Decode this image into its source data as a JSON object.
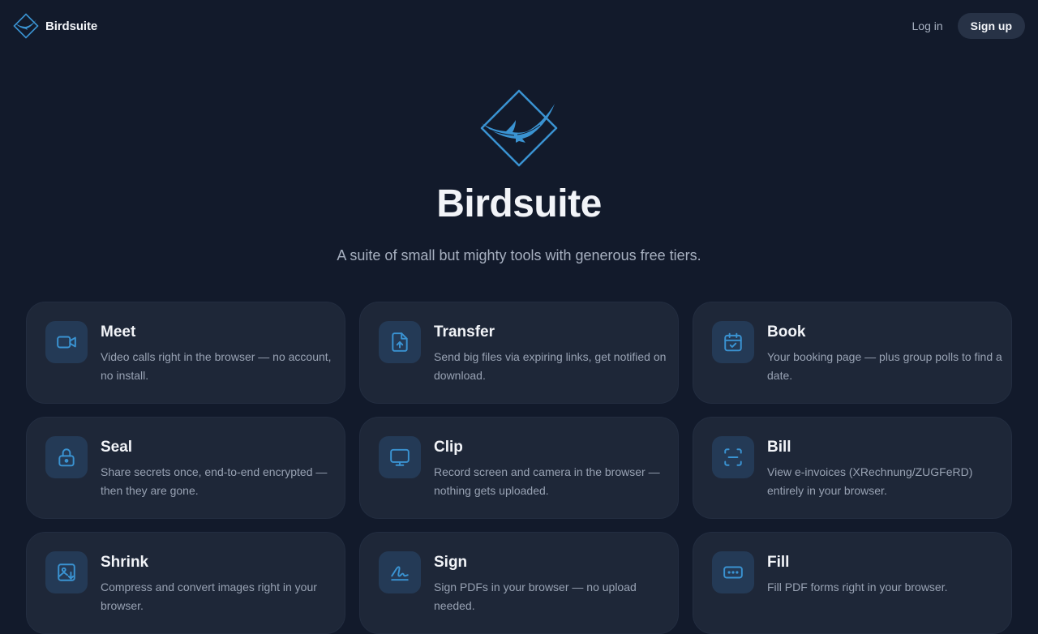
{
  "header": {
    "brand_name": "Birdsuite",
    "login_label": "Log in",
    "signup_label": "Sign up"
  },
  "hero": {
    "title": "Birdsuite",
    "subtitle": "A suite of small but mighty tools with generous free tiers."
  },
  "colors": {
    "background": "#121a2b",
    "card": "#1e2738",
    "accent": "#3a93d2",
    "icon_tile": "#243a56"
  },
  "tools": [
    {
      "title": "Meet",
      "description": "Video calls right in the browser — no account, no install.",
      "icon": "video-camera-icon"
    },
    {
      "title": "Transfer",
      "description": "Send big files via expiring links, get notified on download.",
      "icon": "file-upload-icon"
    },
    {
      "title": "Book",
      "description": "Your booking page — plus group polls to find a date.",
      "icon": "calendar-check-icon"
    },
    {
      "title": "Seal",
      "description": "Share secrets once, end-to-end encrypted — then they are gone.",
      "icon": "lock-icon"
    },
    {
      "title": "Clip",
      "description": "Record screen and camera in the browser — nothing gets uploaded.",
      "icon": "monitor-icon"
    },
    {
      "title": "Bill",
      "description": "View e-invoices (XRechnung/ZUGFeRD) entirely in your browser.",
      "icon": "scan-icon"
    },
    {
      "title": "Shrink",
      "description": "Compress and convert images right in your browser.",
      "icon": "image-download-icon"
    },
    {
      "title": "Sign",
      "description": "Sign PDFs in your browser — no upload needed.",
      "icon": "signature-icon"
    },
    {
      "title": "Fill",
      "description": "Fill PDF forms right in your browser.",
      "icon": "form-field-icon"
    }
  ]
}
